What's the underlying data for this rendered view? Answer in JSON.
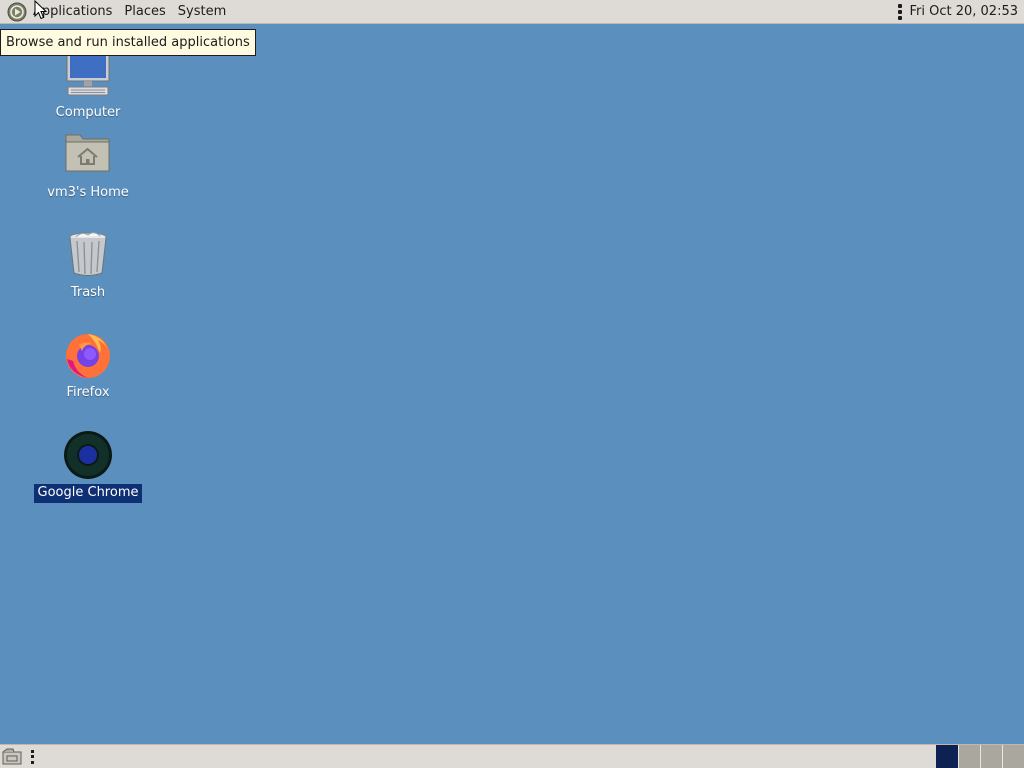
{
  "top_panel": {
    "menus": [
      "Applications",
      "Places",
      "System"
    ],
    "clock": "Fri Oct 20, 02:53"
  },
  "tooltip": "Browse and run installed applications",
  "desktop_icons": [
    {
      "label": "Computer",
      "icon": "computer-icon",
      "selected": false
    },
    {
      "label": "vm3's Home",
      "icon": "home-folder-icon",
      "selected": false
    },
    {
      "label": "Trash",
      "icon": "trash-icon",
      "selected": false
    },
    {
      "label": "Firefox",
      "icon": "firefox-icon",
      "selected": false
    },
    {
      "label": "Google Chrome",
      "icon": "chrome-icon",
      "selected": true
    }
  ],
  "bottom_panel": {
    "workspaces": 4,
    "active_workspace": 1
  },
  "colors": {
    "desktop_background": "#5b8fbe",
    "panel": "#dedbd6",
    "selection": "#0f2f75",
    "active_workspace": "#0d2252"
  }
}
